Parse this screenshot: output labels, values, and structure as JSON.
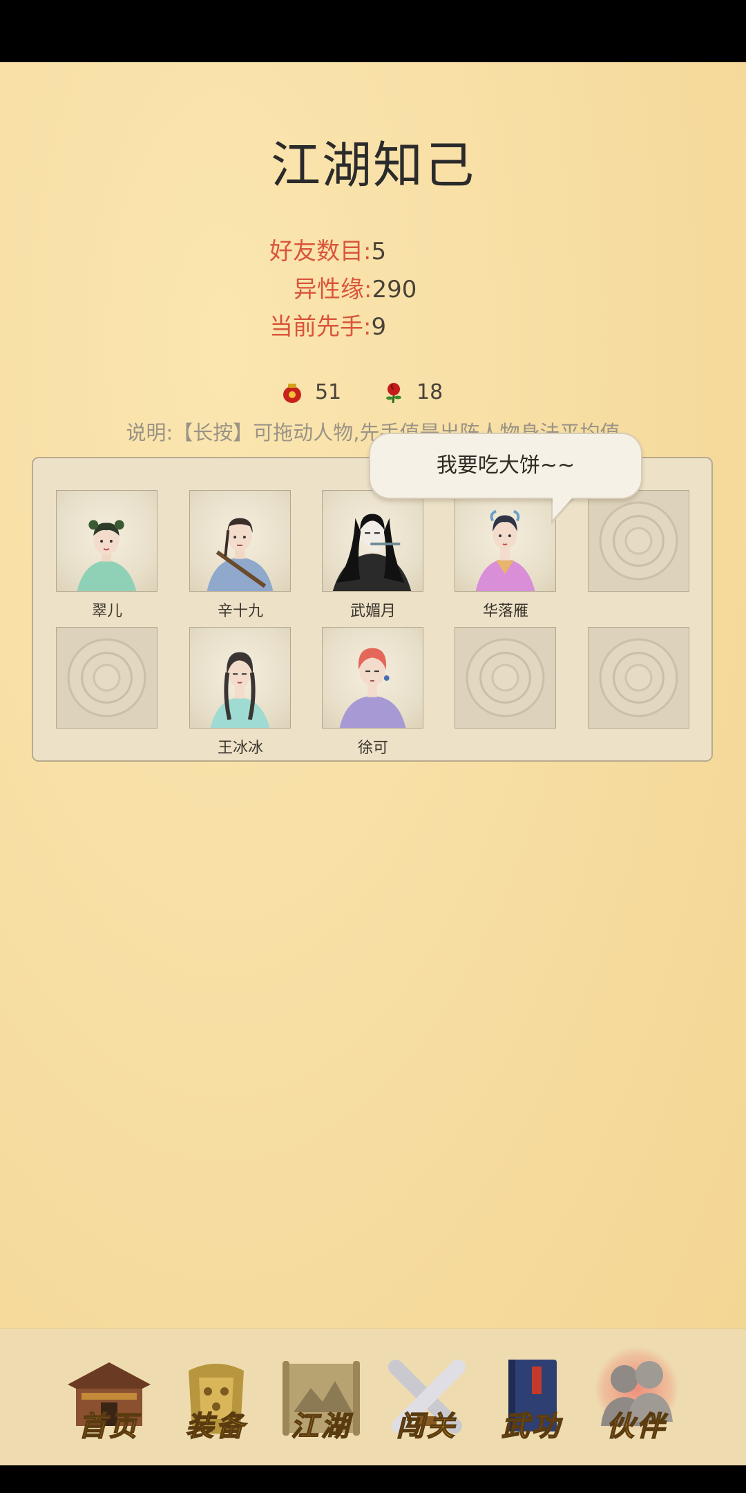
{
  "page": {
    "title": "江湖知己",
    "stats": [
      {
        "label": "好友数目:",
        "value": "5"
      },
      {
        "label": "异性缘:",
        "value": "290"
      },
      {
        "label": "当前先手:",
        "value": "9"
      }
    ],
    "resources": [
      {
        "icon": "red-pouch-icon",
        "value": "51"
      },
      {
        "icon": "rose-icon",
        "value": "18"
      }
    ],
    "note": "说明:【长按】可拖动人物,先手值是出阵人物身法平均值"
  },
  "bubble": {
    "text": "我要吃大饼~~"
  },
  "companions": {
    "row1": [
      {
        "name": "翠儿",
        "portrait": "cuier-portrait"
      },
      {
        "name": "辛十九",
        "portrait": "xin-shijiu-portrait"
      },
      {
        "name": "武媚月",
        "portrait": "wu-meiyue-portrait"
      },
      {
        "name": "华落雁",
        "portrait": "hua-luoyan-portrait"
      },
      {
        "name": "",
        "portrait": "empty-slot"
      }
    ],
    "row2": [
      {
        "name": "",
        "portrait": "empty-slot"
      },
      {
        "name": "王冰冰",
        "portrait": "wang-bingbing-portrait"
      },
      {
        "name": "徐可",
        "portrait": "xu-ke-portrait"
      },
      {
        "name": "",
        "portrait": "empty-slot"
      },
      {
        "name": "",
        "portrait": "empty-slot"
      }
    ]
  },
  "nav": {
    "items": [
      {
        "label": "首页",
        "icon": "house-icon"
      },
      {
        "label": "装备",
        "icon": "armor-icon"
      },
      {
        "label": "江湖",
        "icon": "scroll-map-icon"
      },
      {
        "label": "闯关",
        "icon": "crossed-swords-icon"
      },
      {
        "label": "武功",
        "icon": "book-icon"
      },
      {
        "label": "伙伴",
        "icon": "partners-icon"
      }
    ],
    "active": "伙伴"
  },
  "colors": {
    "background": "#f7dea2",
    "accent_label": "#d9553b",
    "nav_text": "#e7a91c"
  }
}
